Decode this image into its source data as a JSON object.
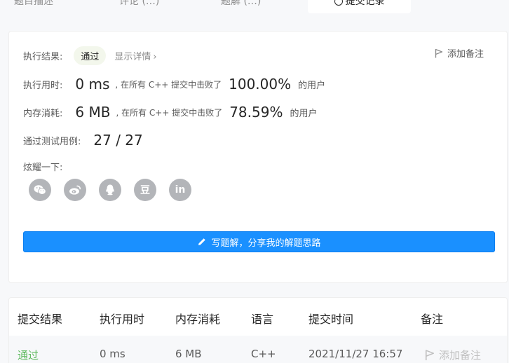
{
  "tabs": [
    {
      "label": "题目描述"
    },
    {
      "label": "评论 (…)"
    },
    {
      "label": "题解 (…)"
    },
    {
      "label": "提交记录"
    }
  ],
  "result": {
    "status_label": "执行结果:",
    "status_value": "通过",
    "detail_link": "显示详情",
    "add_note": "添加备注",
    "runtime_label": "执行用时:",
    "runtime_value": "0 ms",
    "beat_prefix": ", 在所有 C++ 提交中击败了",
    "runtime_pct": "100.00%",
    "users_suffix": "的用户",
    "memory_label": "内存消耗:",
    "memory_value": "6 MB",
    "memory_pct": "78.59%",
    "tests_label": "通过测试用例:",
    "tests_value": "27 / 27",
    "share_label": "炫耀一下:",
    "share_icons": [
      "wechat-icon",
      "weibo-icon",
      "qq-icon",
      "douban-icon",
      "linkedin-icon"
    ],
    "douban_glyph": "豆",
    "linkedin_glyph": "in",
    "solution_button": "写题解，分享我的解题思路"
  },
  "table": {
    "headers": [
      "提交结果",
      "执行用时",
      "内存消耗",
      "语言",
      "提交时间",
      "备注"
    ],
    "row": {
      "status": "通过",
      "runtime": "0 ms",
      "memory": "6 MB",
      "language": "C++",
      "time": "2021/11/27 16:57",
      "note": "添加备注"
    }
  },
  "colors": {
    "accent": "#1a90ff",
    "success": "#5cb85c",
    "icon_gray": "#b3b5b9"
  }
}
